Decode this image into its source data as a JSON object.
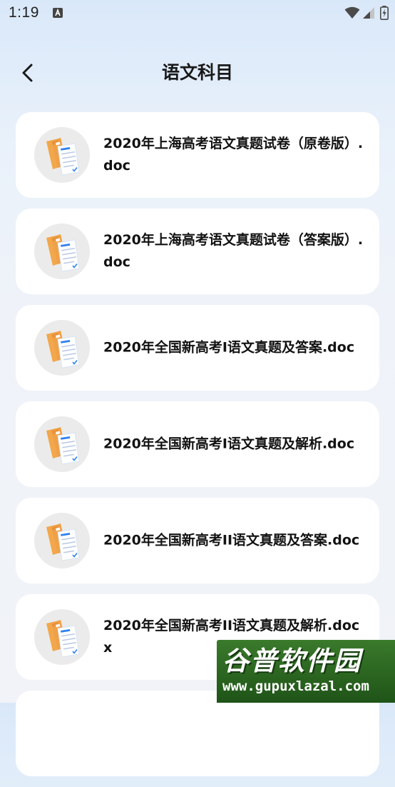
{
  "status_bar": {
    "time": "1:19",
    "icons": [
      "notification-a-icon",
      "wifi-icon",
      "signal-icon",
      "battery-icon"
    ]
  },
  "header": {
    "title": "语文科目",
    "back_icon": "chevron-left-icon"
  },
  "files": [
    {
      "name": "2020年上海高考语文真题试卷（原卷版）.doc",
      "icon": "document-folder-icon"
    },
    {
      "name": "2020年上海高考语文真题试卷（答案版）.doc",
      "icon": "document-folder-icon"
    },
    {
      "name": "2020年全国新高考I语文真题及答案.doc",
      "icon": "document-folder-icon"
    },
    {
      "name": "2020年全国新高考I语文真题及解析.doc",
      "icon": "document-folder-icon"
    },
    {
      "name": "2020年全国新高考II语文真题及答案.doc",
      "icon": "document-folder-icon"
    },
    {
      "name": "2020年全国新高考II语文真题及解析.docx",
      "icon": "document-folder-icon"
    }
  ],
  "watermark": {
    "title": "谷普软件园",
    "url": "www.gupuxlazal.com"
  },
  "colors": {
    "background_top": "#d9e8f9",
    "background_bottom": "#f1f3f8",
    "card": "#ffffff",
    "folder": "#f0a54a",
    "watermark": "#2b6520"
  }
}
